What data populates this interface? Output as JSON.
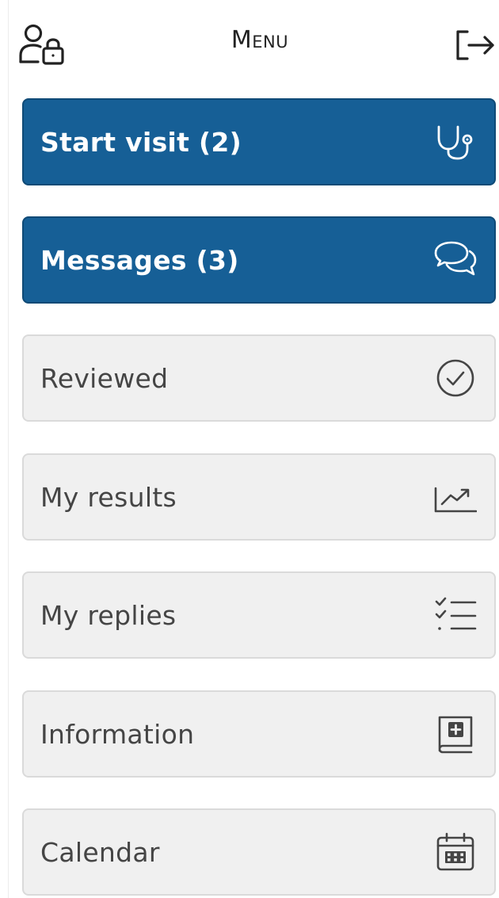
{
  "header": {
    "title": "Menu",
    "profile_icon": "user-lock-icon",
    "logout_icon": "logout-icon"
  },
  "colors": {
    "primary": "#165f96",
    "secondary_bg": "#f0f0f0",
    "secondary_text": "#454545"
  },
  "menu": {
    "items": [
      {
        "label": "Start visit (2)",
        "icon": "stethoscope-icon",
        "style": "primary"
      },
      {
        "label": "Messages (3)",
        "icon": "chat-bubbles-icon",
        "style": "primary"
      },
      {
        "label": "Reviewed",
        "icon": "check-circle-icon",
        "style": "secondary"
      },
      {
        "label": "My results",
        "icon": "trend-chart-icon",
        "style": "secondary"
      },
      {
        "label": "My replies",
        "icon": "checklist-icon",
        "style": "secondary"
      },
      {
        "label": "Information",
        "icon": "medical-book-icon",
        "style": "secondary"
      },
      {
        "label": "Calendar",
        "icon": "calendar-icon",
        "style": "secondary"
      }
    ]
  }
}
